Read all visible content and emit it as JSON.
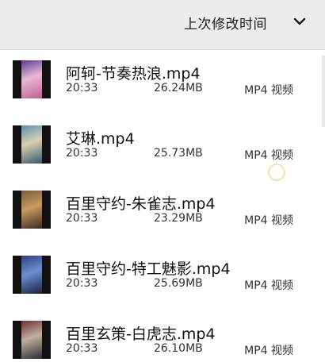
{
  "sort": {
    "label": "上次修改时间",
    "chevron_icon": "chevron-down-icon"
  },
  "files": [
    {
      "name": "阿轲-节奏热浪.mp4",
      "time": "20:33",
      "size": "26.24MB",
      "type": "MP4 视频",
      "thumb_colors": [
        "#5a3b8a",
        "#e9b8d8",
        "#c06090"
      ]
    },
    {
      "name": "艾琳.mp4",
      "time": "20:33",
      "size": "25.73MB",
      "type": "MP4 视频",
      "thumb_colors": [
        "#5f8fb5",
        "#d8d0b0",
        "#3a5570"
      ]
    },
    {
      "name": "百里守约-朱雀志.mp4",
      "time": "20:33",
      "size": "23.29MB",
      "type": "MP4 视频",
      "thumb_colors": [
        "#7a5a3a",
        "#c89b60",
        "#3c2a20"
      ]
    },
    {
      "name": "百里守约-特工魅影.mp4",
      "time": "20:33",
      "size": "25.69MB",
      "type": "MP4 视频",
      "thumb_colors": [
        "#2c3f7a",
        "#6f8fd0",
        "#1a2040"
      ]
    },
    {
      "name": "百里玄策-白虎志.mp4",
      "time": "20:33",
      "size": "26.10MB",
      "type": "MP4 视频",
      "thumb_colors": [
        "#6a3030",
        "#c0b0a0",
        "#2a2a35"
      ]
    }
  ]
}
